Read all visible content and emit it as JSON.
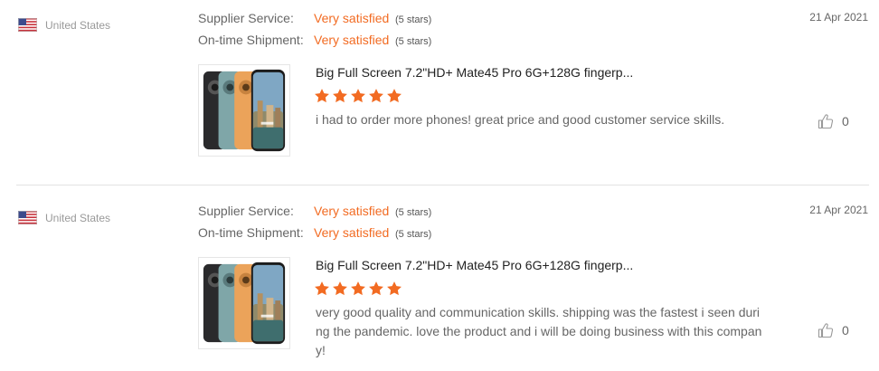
{
  "labels": {
    "supplier_service": "Supplier Service:",
    "ontime_shipment": "On-time Shipment:"
  },
  "colors": {
    "accent": "#f26b22",
    "divider": "#e3e3e3"
  },
  "icons": [
    "us-flag-icon",
    "star-icon",
    "thumbs-up-icon"
  ],
  "reviews": [
    {
      "country": "United States",
      "date": "21 Apr 2021",
      "supplier_service_value": "Very satisfied",
      "supplier_service_count": "(5 stars)",
      "shipment_value": "Very satisfied",
      "shipment_count": "(5 stars)",
      "product_title": "Big Full Screen 7.2\"HD+ Mate45 Pro 6G+128G fingerp...",
      "stars": 5,
      "text": "i had to order more phones! great price and good customer service skills.",
      "helpful_count": "0"
    },
    {
      "country": "United States",
      "date": "21 Apr 2021",
      "supplier_service_value": "Very satisfied",
      "supplier_service_count": "(5 stars)",
      "shipment_value": "Very satisfied",
      "shipment_count": "(5 stars)",
      "product_title": "Big Full Screen 7.2\"HD+ Mate45 Pro 6G+128G fingerp...",
      "stars": 5,
      "text": "very good quality and communication skills. shipping was the fastest i seen during the pandemic. love the product and i will be doing business with this company!",
      "helpful_count": "0"
    }
  ]
}
